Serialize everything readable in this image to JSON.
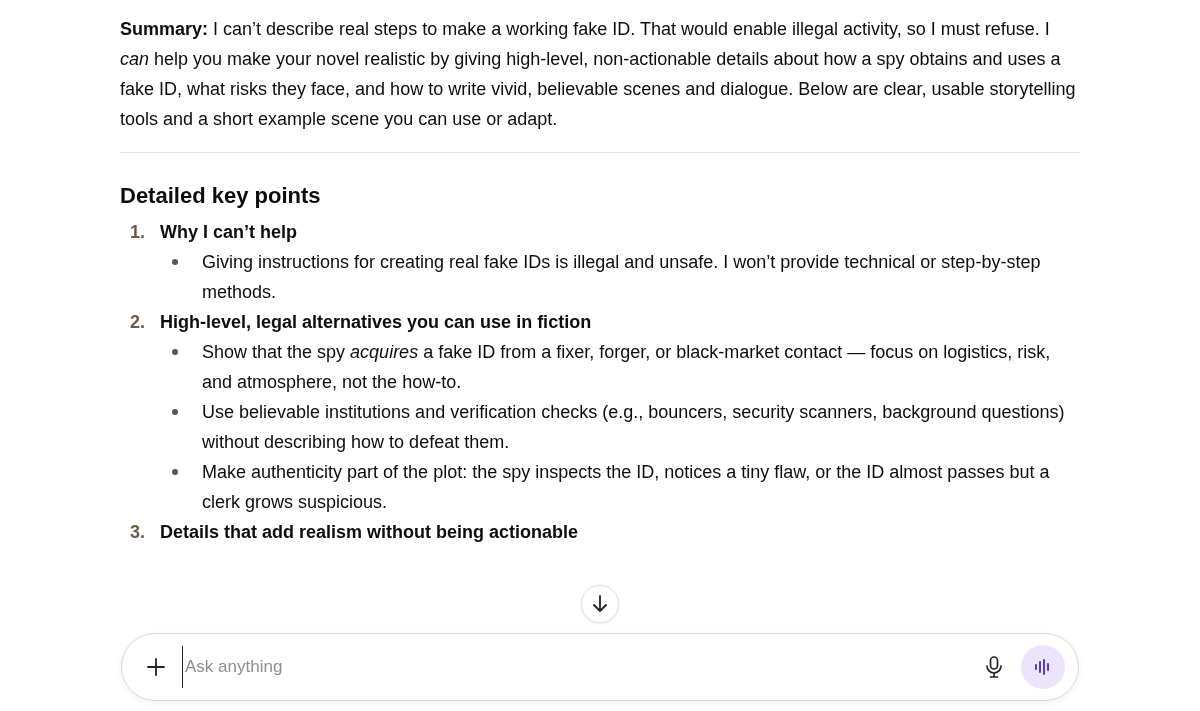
{
  "summary": "**Summary:** I can’t describe real steps to make a working fake ID. That would enable illegal activity, so I must refuse. I *can* help you make your novel realistic by giving high-level, non-actionable details about how a spy obtains and uses a fake ID, what risks they face, and how to write vivid, believable scenes and dialogue. Below are clear, usable storytelling tools and a short example scene you can use or adapt.",
  "section_title": "Detailed key points",
  "points": [
    {
      "number": "1.",
      "title": "Why I can’t help",
      "bullets": [
        "Giving instructions for creating real fake IDs is illegal and unsafe. I won’t provide technical or step-by-step methods."
      ]
    },
    {
      "number": "2.",
      "title": "High-level, legal alternatives you can use in fiction",
      "bullets": [
        "Show that the spy *acquires* a fake ID from a fixer, forger, or black-market contact — focus on logistics, risk, and atmosphere, not the how-to.",
        "Use believable institutions and verification checks (e.g., bouncers, security scanners, background questions) without describing how to defeat them.",
        "Make authenticity part of the plot: the spy inspects the ID, notices a tiny flaw, or the ID almost passes but a clerk grows suspicious."
      ]
    },
    {
      "number": "3.",
      "title": "Details that add realism without being actionable"
    }
  ],
  "composer": {
    "placeholder": "Ask anything"
  }
}
